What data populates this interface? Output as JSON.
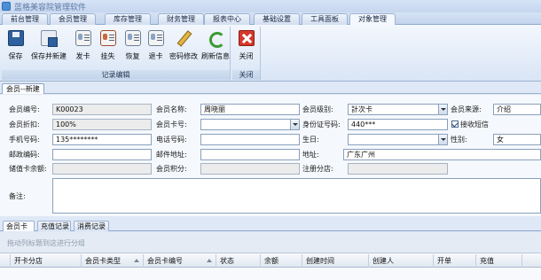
{
  "app": {
    "title": "蓝格美容院管理软件"
  },
  "menu_tabs": [
    "前台管理",
    "会员管理",
    "库存管理",
    "财务管理",
    "报表中心",
    "基础设置",
    "工具面板",
    "对象管理"
  ],
  "ribbon": {
    "buttons": [
      {
        "label": "保存",
        "icon": "save-icon"
      },
      {
        "label": "保存并新建",
        "icon": "save-new-icon"
      },
      {
        "label": "发卡",
        "icon": "issue-card-icon"
      },
      {
        "label": "挂失",
        "icon": "report-loss-icon"
      },
      {
        "label": "恢复",
        "icon": "restore-card-icon"
      },
      {
        "label": "退卡",
        "icon": "return-card-icon"
      },
      {
        "label": "密码修改",
        "icon": "edit-password-icon"
      },
      {
        "label": "刷新信息",
        "icon": "refresh-icon"
      }
    ],
    "group_caption": "记录编辑",
    "close": {
      "label": "关闭",
      "icon": "close-icon"
    },
    "close_caption": "关闭"
  },
  "doc_tab": "会员--新建",
  "form": {
    "member_no_label": "会员编号:",
    "member_no": "K00023",
    "member_name_label": "会员名称:",
    "member_name": "周晓丽",
    "member_level_label": "会员级别:",
    "member_level": "計次卡",
    "member_source_label": "会员来源:",
    "member_source": "介绍",
    "discount_label": "会员折扣:",
    "discount": "100%",
    "card_no_label": "会员卡号:",
    "card_no": "",
    "id_no_label": "身份证号码:",
    "id_no": "440***",
    "receive_sms_label": "接收短信",
    "mobile_label": "手机号码:",
    "mobile": "135********",
    "phone_label": "电话号码:",
    "phone": "",
    "birthday_label": "生日:",
    "birthday": "",
    "gender_label": "性别:",
    "gender": "女",
    "postcode_label": "邮政编码:",
    "postcode": "",
    "email_label": "邮件地址:",
    "email": "",
    "address_label": "地址:",
    "address": "广东广州",
    "stored_balance_label": "储值卡余额:",
    "stored_balance": "",
    "points_label": "会员积分:",
    "points": "",
    "branch_label": "注册分店:",
    "branch": "",
    "remark_label": "备注:"
  },
  "sub_tabs": [
    "会员卡",
    "充值记录",
    "消费记录"
  ],
  "grid": {
    "group_hint": "拖动列标题到这进行分组",
    "columns": [
      "开卡分店",
      "会员卡类型",
      "会员卡编号",
      "状态",
      "余额",
      "创建时间",
      "创建人",
      "开单",
      "充值"
    ]
  }
}
